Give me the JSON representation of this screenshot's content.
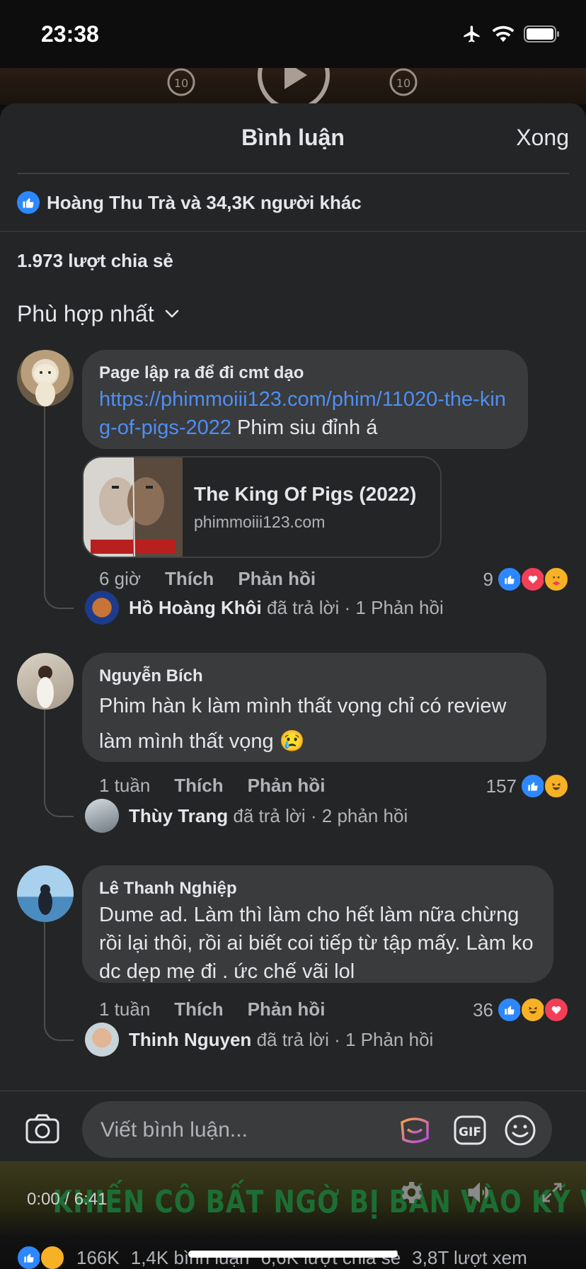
{
  "status": {
    "time": "23:38"
  },
  "sheet": {
    "title": "Bình luận",
    "done_label": "Xong",
    "likes_summary": "Hoàng Thu Trà và 34,3K người khác",
    "shares": "1.973 lượt chia sẻ",
    "sort_label": "Phù hợp nhất"
  },
  "comments": [
    {
      "author": "Page lập ra để đi cmt dạo",
      "link_text": "https://phimmoiii123.com/phim/11020-the-king-of-pigs-2022",
      "text": " Phim siu đỉnh á",
      "link_preview": {
        "title": "The King Of Pigs (2022)",
        "domain": "phimmoiii123.com"
      },
      "time": "6 giờ",
      "like_label": "Thích",
      "reply_label": "Phản hồi",
      "reaction_count": "9",
      "reactions": [
        "like",
        "love",
        "care"
      ],
      "reply_author": "Hồ Hoàng Khôi",
      "reply_action": "đã trả lời",
      "reply_count": "· 1 Phản hồi"
    },
    {
      "author": "Nguyễn Bích",
      "text": "Phim hàn k làm mình thất vọng chỉ có review làm mình thất vọng 😢",
      "time": "1 tuần",
      "like_label": "Thích",
      "reply_label": "Phản hồi",
      "reaction_count": "157",
      "reactions": [
        "like",
        "haha"
      ],
      "reply_author": "Thùy Trang",
      "reply_action": "đã trả lời",
      "reply_count": "· 2 phản hồi"
    },
    {
      "author": "Lê Thanh Nghiệp",
      "text": "Dume ad. Làm thì làm cho hết làm nữa chừng rồi lại thôi, rồi ai biết coi tiếp từ tập mấy. Làm ko dc dẹp mẹ đi . ức chế vãi lol",
      "time": "1 tuần",
      "like_label": "Thích",
      "reply_label": "Phản hồi",
      "reaction_count": "36",
      "reactions": [
        "like",
        "haha",
        "love"
      ],
      "reply_author": "Thinh Nguyen",
      "reply_action": "đã trả lời",
      "reply_count": "· 1 Phản hồi"
    }
  ],
  "composer": {
    "placeholder": "Viết bình luận..."
  },
  "video": {
    "caption": "KHIẾN CÔ BẤT NGỜ BỊ BÁN VÀO KỸ VIỆN LÀM GÁI BÁN HOA",
    "time": "0:00 / 6:41",
    "reaction_count": "166K",
    "comments": "1,4K bình luận",
    "shares": "6,6K lượt chia sẻ",
    "views": "3,8T lượt xem"
  },
  "colors": {
    "accent": "#2d88ff",
    "link": "#4d8ff5",
    "love": "#f33e58",
    "haha": "#f7b125"
  }
}
